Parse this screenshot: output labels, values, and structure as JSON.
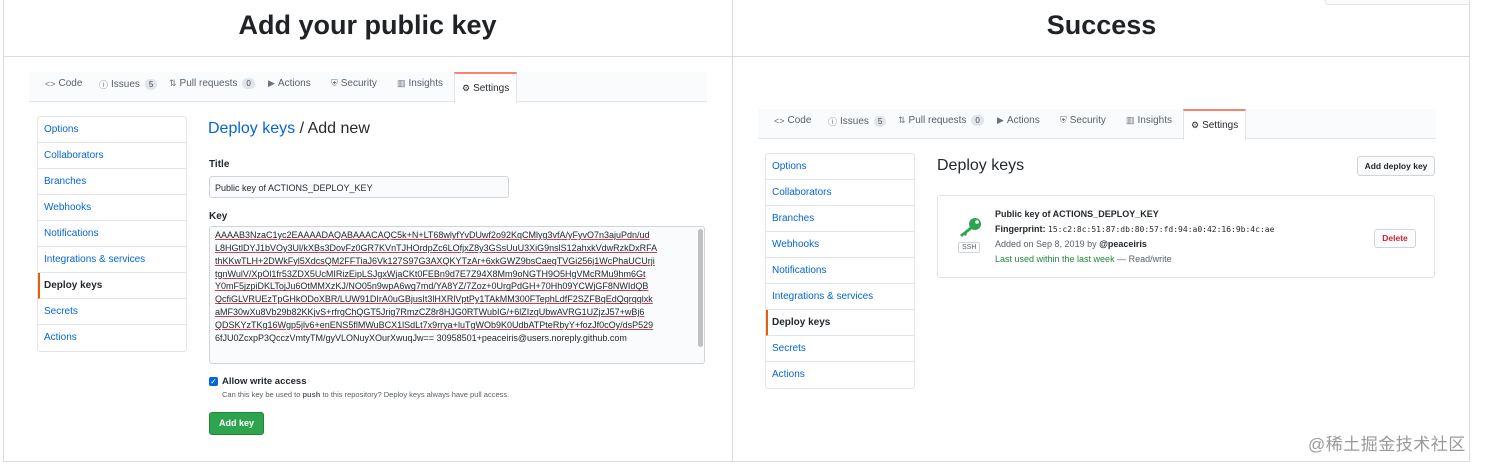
{
  "headers": {
    "left": "Add your public key",
    "right": "Success"
  },
  "tabs": [
    {
      "icon": "<>",
      "label": "Code",
      "count": ""
    },
    {
      "icon": "ⓘ",
      "label": "Issues",
      "count": "5"
    },
    {
      "icon": "⇅",
      "label": "Pull requests",
      "count": "0"
    },
    {
      "icon": "▶",
      "label": "Actions",
      "count": ""
    },
    {
      "icon": "⛨",
      "label": "Security",
      "count": ""
    },
    {
      "icon": "▥",
      "label": "Insights",
      "count": ""
    },
    {
      "icon": "⚙",
      "label": "Settings",
      "count": ""
    }
  ],
  "sidebar_left": [
    "Options",
    "Collaborators",
    "Branches",
    "Webhooks",
    "Notifications",
    "Integrations & services",
    "Deploy keys",
    "Secrets",
    "Actions"
  ],
  "sidebar_right": [
    "Options",
    "Collaborators",
    "Branches",
    "Webhooks",
    "Notifications",
    "Integrations & services",
    "Deploy keys",
    "Secrets",
    "Actions"
  ],
  "selected_sidebar_item": "Deploy keys",
  "add_page": {
    "title_link": "Deploy keys",
    "title_rest": " / Add new",
    "title_label": "Title",
    "title_value": "Public key of ACTIONS_DEPLOY_KEY",
    "key_label": "Key",
    "key_lines": [
      "AAAAB3NzaC1yc2EAAAADAQABAAACAQC5k+N+LT68wlyfYvDUwf2o92KqCMlyg3vfA/yFyvO7n3ajuPdn/ud",
      "L8HGtlDYJ1bVOy3Ul/kXBs3DovFz0GR7KVnTJHOrdpZc6LOfjxZ8y3GSsUuU3XiG9nslS12ahxkVdwRzkDxRFA",
      "thKKwTLH+2DWkFyl5XdcsQM2FFTiaJ6Vk127S97G3AXQKYTzAr+6xkGWZ9bsCaeqTVGi256j1WcPhaUCUrji",
      "tgnWulV/XpOl1fr53ZDX5UcMIRizEipLSJgxWjaCKt0FEBn9d7E7Z94X8Mm9oNGTH9O5HgVMcRMu9hm6Gt",
      "Y0mF5jzpiDKLTojJu6OtMMXzKJ/NO05n9wpA6wg7md/YA8YZ/7Zoz+0UrgPdGH+70Hh09YCWjGF8NWIdQB",
      "QcfiGLVRUEzTpGHkODoXBR/LUW91DIrA0uGBjusIt3lHXRlVptPy1TAkMM300FTephLdfF2SZFBqEdQqrqqlxk",
      "aMF30wXu8Vb29b82KKjvS+rfrgChQGT5Jrig7RmzCZ8r8HJG0RTWubIG/+6lZIzqUbwAVRG1UZjzJ57+wBj6",
      "QDSKYzTKg16Wgp5jlv6+enENS5flMWuBCX1lSdLt7x9rrya+luTgWOb9K0UdbATPteRbyY+fozJf0cOy/dsP529",
      "6fJU0ZcxpP3QcczVmtyTM/gyVLONuyXOurXwuqJw== 30958501+peaceiris@users.noreply.github.com"
    ],
    "checkbox_label": "Allow write access",
    "checkbox_note_pre": "Can this key be used to ",
    "checkbox_note_bold": "push",
    "checkbox_note_post": " to this repository? Deploy keys always have pull access.",
    "submit_label": "Add key"
  },
  "success_page": {
    "title": "Deploy keys",
    "add_button": "Add deploy key",
    "key_icon": "key-icon",
    "key_name": "Public key of ACTIONS_DEPLOY_KEY",
    "fingerprint_label": "Fingerprint:",
    "fingerprint": "15:c2:8c:51:87:db:80:57:fd:94:a0:42:16:9b:4c:ae",
    "added_on": "Added on Sep 8, 2019 by ",
    "added_by": "@peaceiris",
    "last_used": "Last used within the last week",
    "access": " — Read/write",
    "ssh_badge": "SSH",
    "delete_label": "Delete"
  },
  "watermark": "@稀土掘金技术社区",
  "colors": {
    "link": "#0366d6",
    "green": "#2ea44f",
    "tab_accent": "#f9826c",
    "danger": "#cb2431",
    "success_text": "#22863a"
  }
}
